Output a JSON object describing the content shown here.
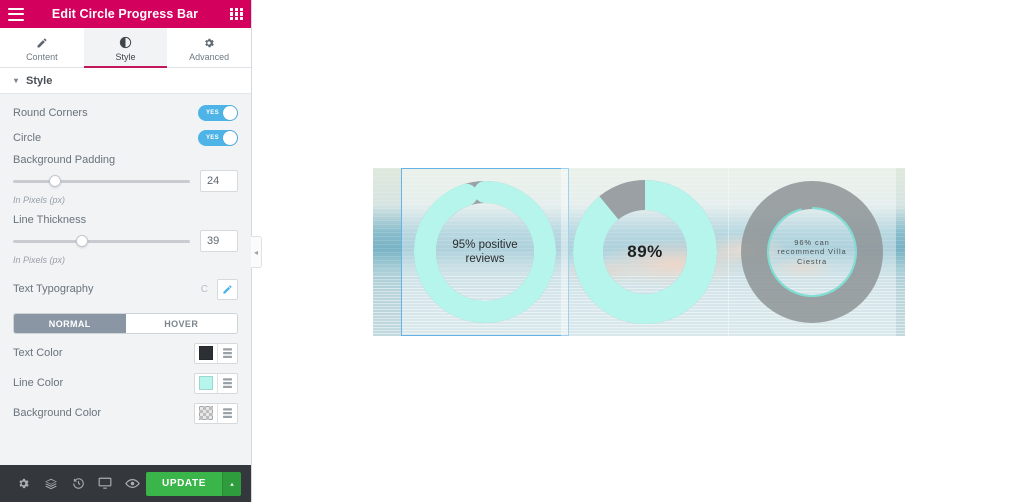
{
  "panel": {
    "header": {
      "title": "Edit Circle Progress Bar",
      "menu_icon": "hamburger-icon",
      "apps_icon": "grid-apps-icon"
    },
    "tabs": [
      {
        "label": "Content",
        "icon": "pencil-icon",
        "active": false
      },
      {
        "label": "Style",
        "icon": "contrast-circle-icon",
        "active": true
      },
      {
        "label": "Advanced",
        "icon": "gear-icon",
        "active": false
      }
    ],
    "section": {
      "title": "Style",
      "caret": "▾"
    },
    "controls": {
      "round_corners": {
        "label": "Round Corners",
        "value": "YES"
      },
      "circle": {
        "label": "Circle",
        "value": "YES"
      },
      "background_padding": {
        "label": "Background Padding",
        "value": "24",
        "percent": 24,
        "hint": "In Pixels (px)"
      },
      "line_thickness": {
        "label": "Line Thickness",
        "value": "39",
        "percent": 39,
        "hint": "In Pixels (px)"
      },
      "text_typography": {
        "label": "Text Typography",
        "reset": "C",
        "edit_icon": "pencil-edit-icon"
      },
      "state_tabs": [
        {
          "label": "NORMAL",
          "active": true
        },
        {
          "label": "HOVER",
          "active": false
        }
      ],
      "text_color": {
        "label": "Text Color",
        "color": "#2c2f33"
      },
      "line_color": {
        "label": "Line Color",
        "color": "#b6f5ec"
      },
      "background_color": {
        "label": "Background Color",
        "color": "transparent"
      }
    },
    "footer": {
      "icons": [
        "gear-icon",
        "layers-icon",
        "history-icon",
        "responsive-icon",
        "preview-eye-icon"
      ],
      "update_label": "UPDATE",
      "update_caret": "▴"
    },
    "collapse_tab": {
      "icon": "chevron-left-icon",
      "glyph": "◂"
    }
  },
  "canvas": {
    "widgets": [
      {
        "name": "circle-progress-95",
        "caption": "95% positive reviews",
        "percent": 95,
        "selected": true,
        "ring_color": "#b6f5ec",
        "track_color": "#9aa0a3",
        "thickness": 22
      },
      {
        "name": "circle-progress-89",
        "caption": "89%",
        "percent": 89,
        "selected": false,
        "ring_color": "#b6f5ec",
        "track_color": "#9aa0a3",
        "thickness": 30
      },
      {
        "name": "circle-progress-96",
        "caption": "96% can recommend Villa Ciestra",
        "percent": 96,
        "selected": false,
        "ring_color": "#7fdfd4",
        "track_color": "#8e9496",
        "thickness": 2
      }
    ]
  }
}
